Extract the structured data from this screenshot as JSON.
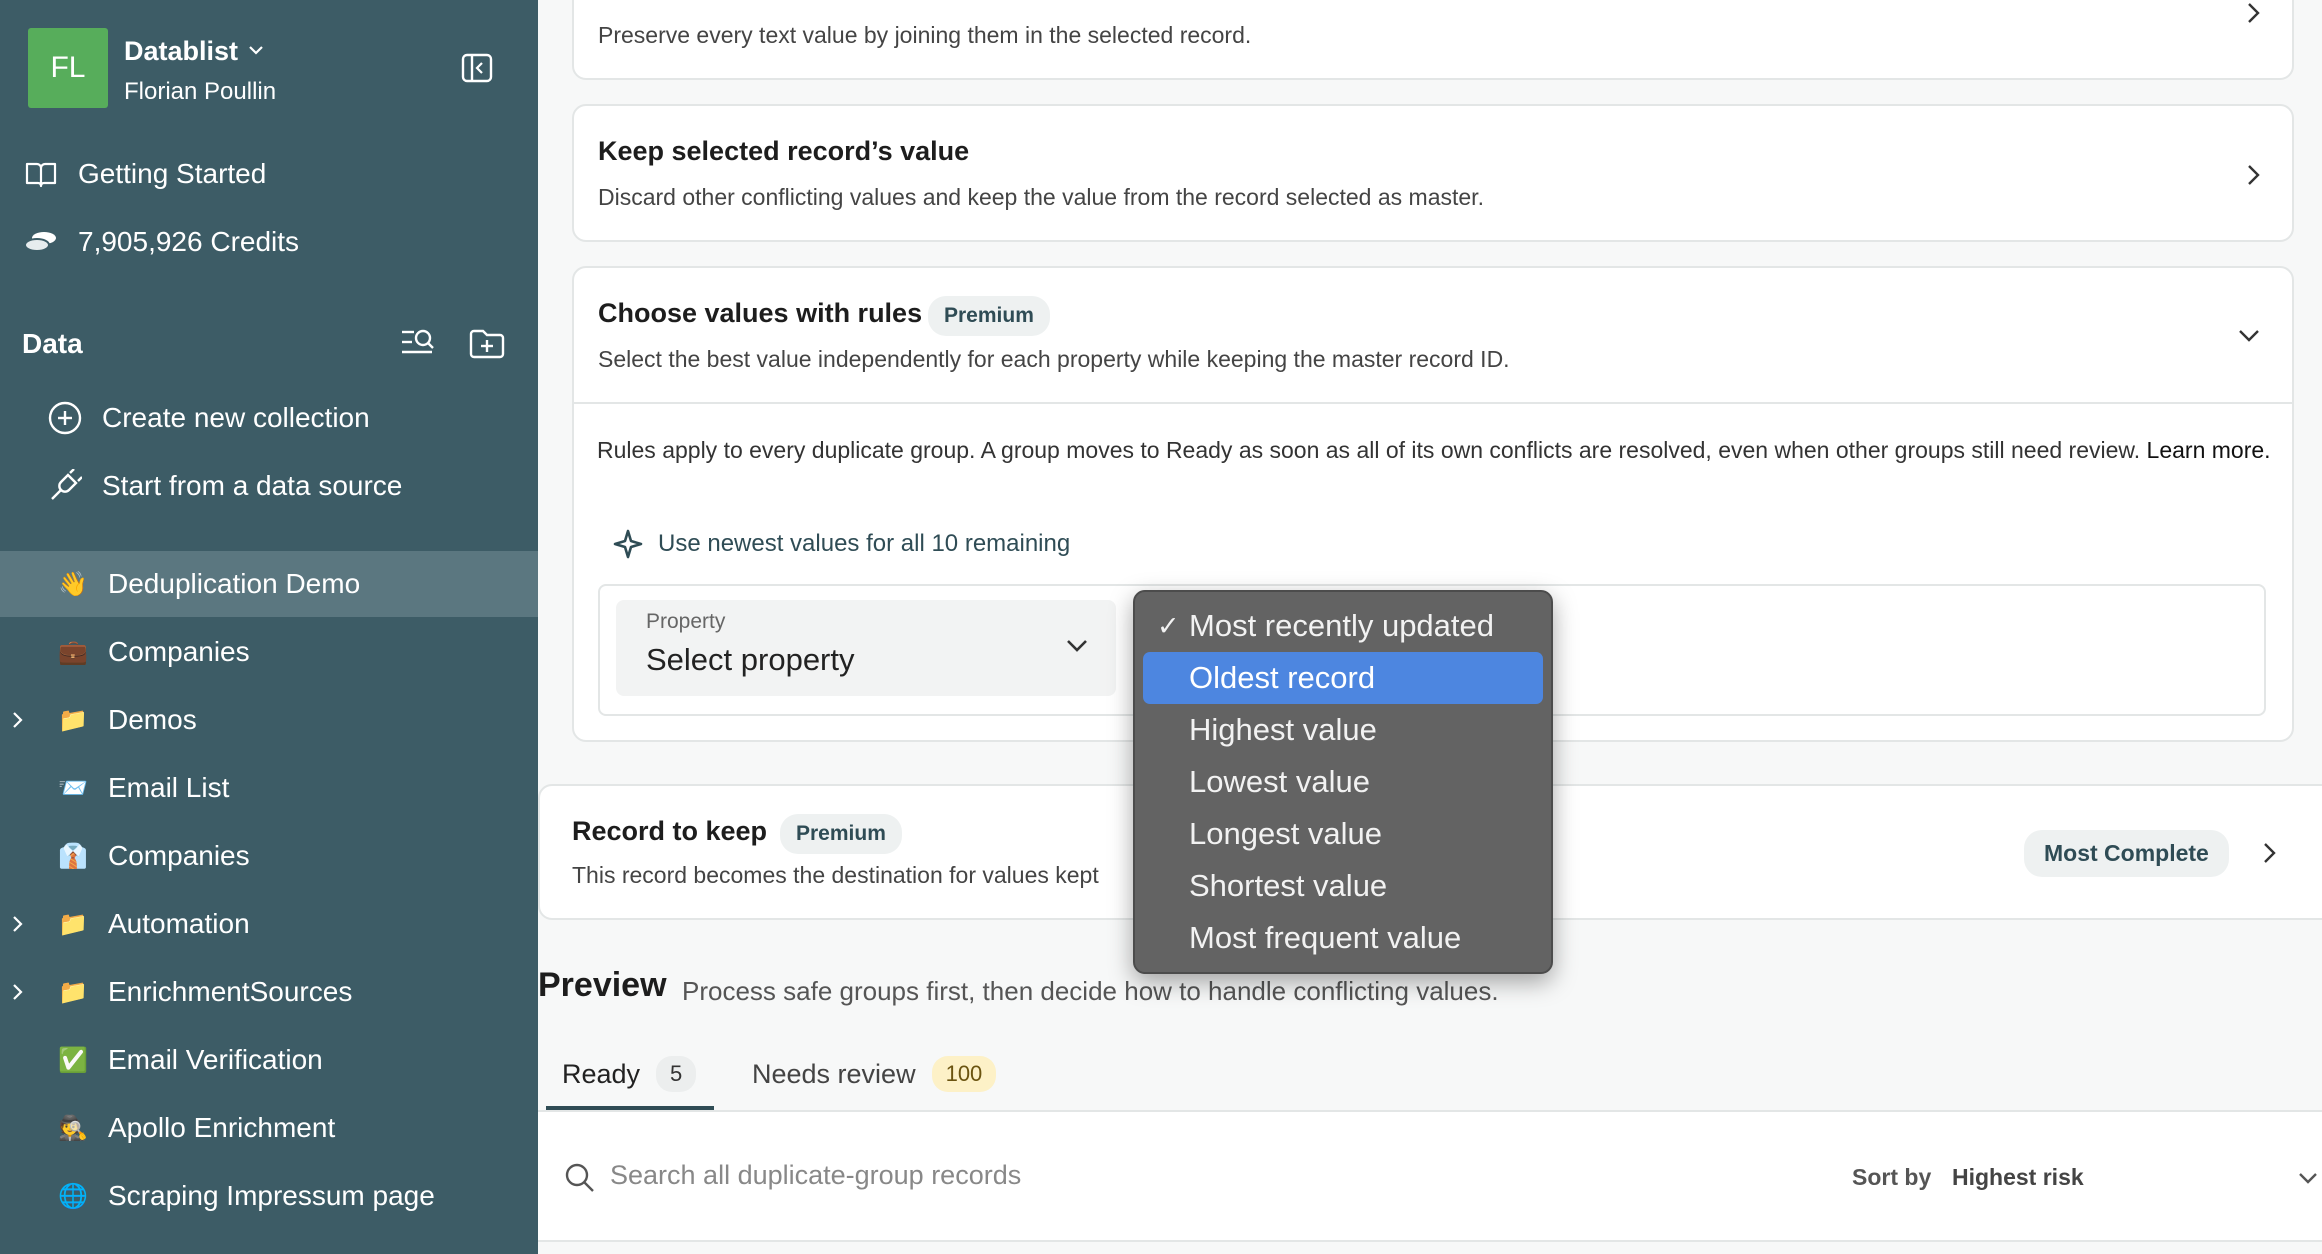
{
  "workspace": {
    "initials": "FL",
    "name": "Datablist",
    "user": "Florian Poullin"
  },
  "nav": {
    "getting_started": "Getting Started",
    "credits": "7,905,926 Credits"
  },
  "data_section": {
    "title": "Data",
    "create": "Create new collection",
    "data_source": "Start from a data source"
  },
  "collections": [
    {
      "emoji": "👋",
      "label": "Deduplication Demo",
      "active": true,
      "expandable": false
    },
    {
      "emoji": "💼",
      "label": "Companies",
      "active": false,
      "expandable": false
    },
    {
      "emoji": "📁",
      "label": "Demos",
      "active": false,
      "expandable": true
    },
    {
      "emoji": "📨",
      "label": "Email List",
      "active": false,
      "expandable": false
    },
    {
      "emoji": "👔",
      "label": "Companies",
      "active": false,
      "expandable": false
    },
    {
      "emoji": "📁",
      "label": "Automation",
      "active": false,
      "expandable": true
    },
    {
      "emoji": "📁",
      "label": "EnrichmentSources",
      "active": false,
      "expandable": true
    },
    {
      "emoji": "✅",
      "label": "Email Verification",
      "active": false,
      "expandable": false
    },
    {
      "emoji": "🕵️",
      "label": "Apollo Enrichment",
      "active": false,
      "expandable": false
    },
    {
      "emoji": "🌐",
      "label": "Scraping Impressum page",
      "active": false,
      "expandable": false
    }
  ],
  "merge_options": {
    "join_desc": "Preserve every text value by joining them in the selected record.",
    "keep_title": "Keep selected record’s value",
    "keep_desc": "Discard other conflicting values and keep the value from the record selected as master.",
    "rules_title": "Choose values with rules",
    "rules_badge": "Premium",
    "rules_desc": "Select the best value independently for each property while keeping the master record ID.",
    "rules_text": "Rules apply to every duplicate group. A group moves to Ready as soon as all of its own conflicts are resolved, even when other groups still need review.",
    "learn_more": "Learn more.",
    "newest_action": "Use newest values for all 10 remaining",
    "property_label": "Property",
    "property_value": "Select property"
  },
  "dropdown": {
    "options": [
      {
        "label": "Most recently updated",
        "checked": true,
        "highlighted": false
      },
      {
        "label": "Oldest record",
        "checked": false,
        "highlighted": true
      },
      {
        "label": "Highest value",
        "checked": false,
        "highlighted": false
      },
      {
        "label": "Lowest value",
        "checked": false,
        "highlighted": false
      },
      {
        "label": "Longest value",
        "checked": false,
        "highlighted": false
      },
      {
        "label": "Shortest value",
        "checked": false,
        "highlighted": false
      },
      {
        "label": "Most frequent value",
        "checked": false,
        "highlighted": false
      }
    ]
  },
  "record_keep": {
    "title": "Record to keep",
    "badge": "Premium",
    "desc": "This record becomes the destination for values kept",
    "value": "Most Complete"
  },
  "preview": {
    "title": "Preview",
    "subtitle": "Process safe groups first, then decide how to handle conflicting values.",
    "tabs": [
      {
        "label": "Ready",
        "count": "5"
      },
      {
        "label": "Needs review",
        "count": "100"
      }
    ],
    "search_placeholder": "Search all duplicate-group records",
    "sort_label": "Sort by",
    "sort_value": "Highest risk"
  },
  "colors": {
    "sidebar": "#3d5c66",
    "accent": "#2f4c55",
    "highlight": "#4d86e0",
    "avatar": "#57ad5b",
    "warning_badge": "#fdf1c7"
  }
}
